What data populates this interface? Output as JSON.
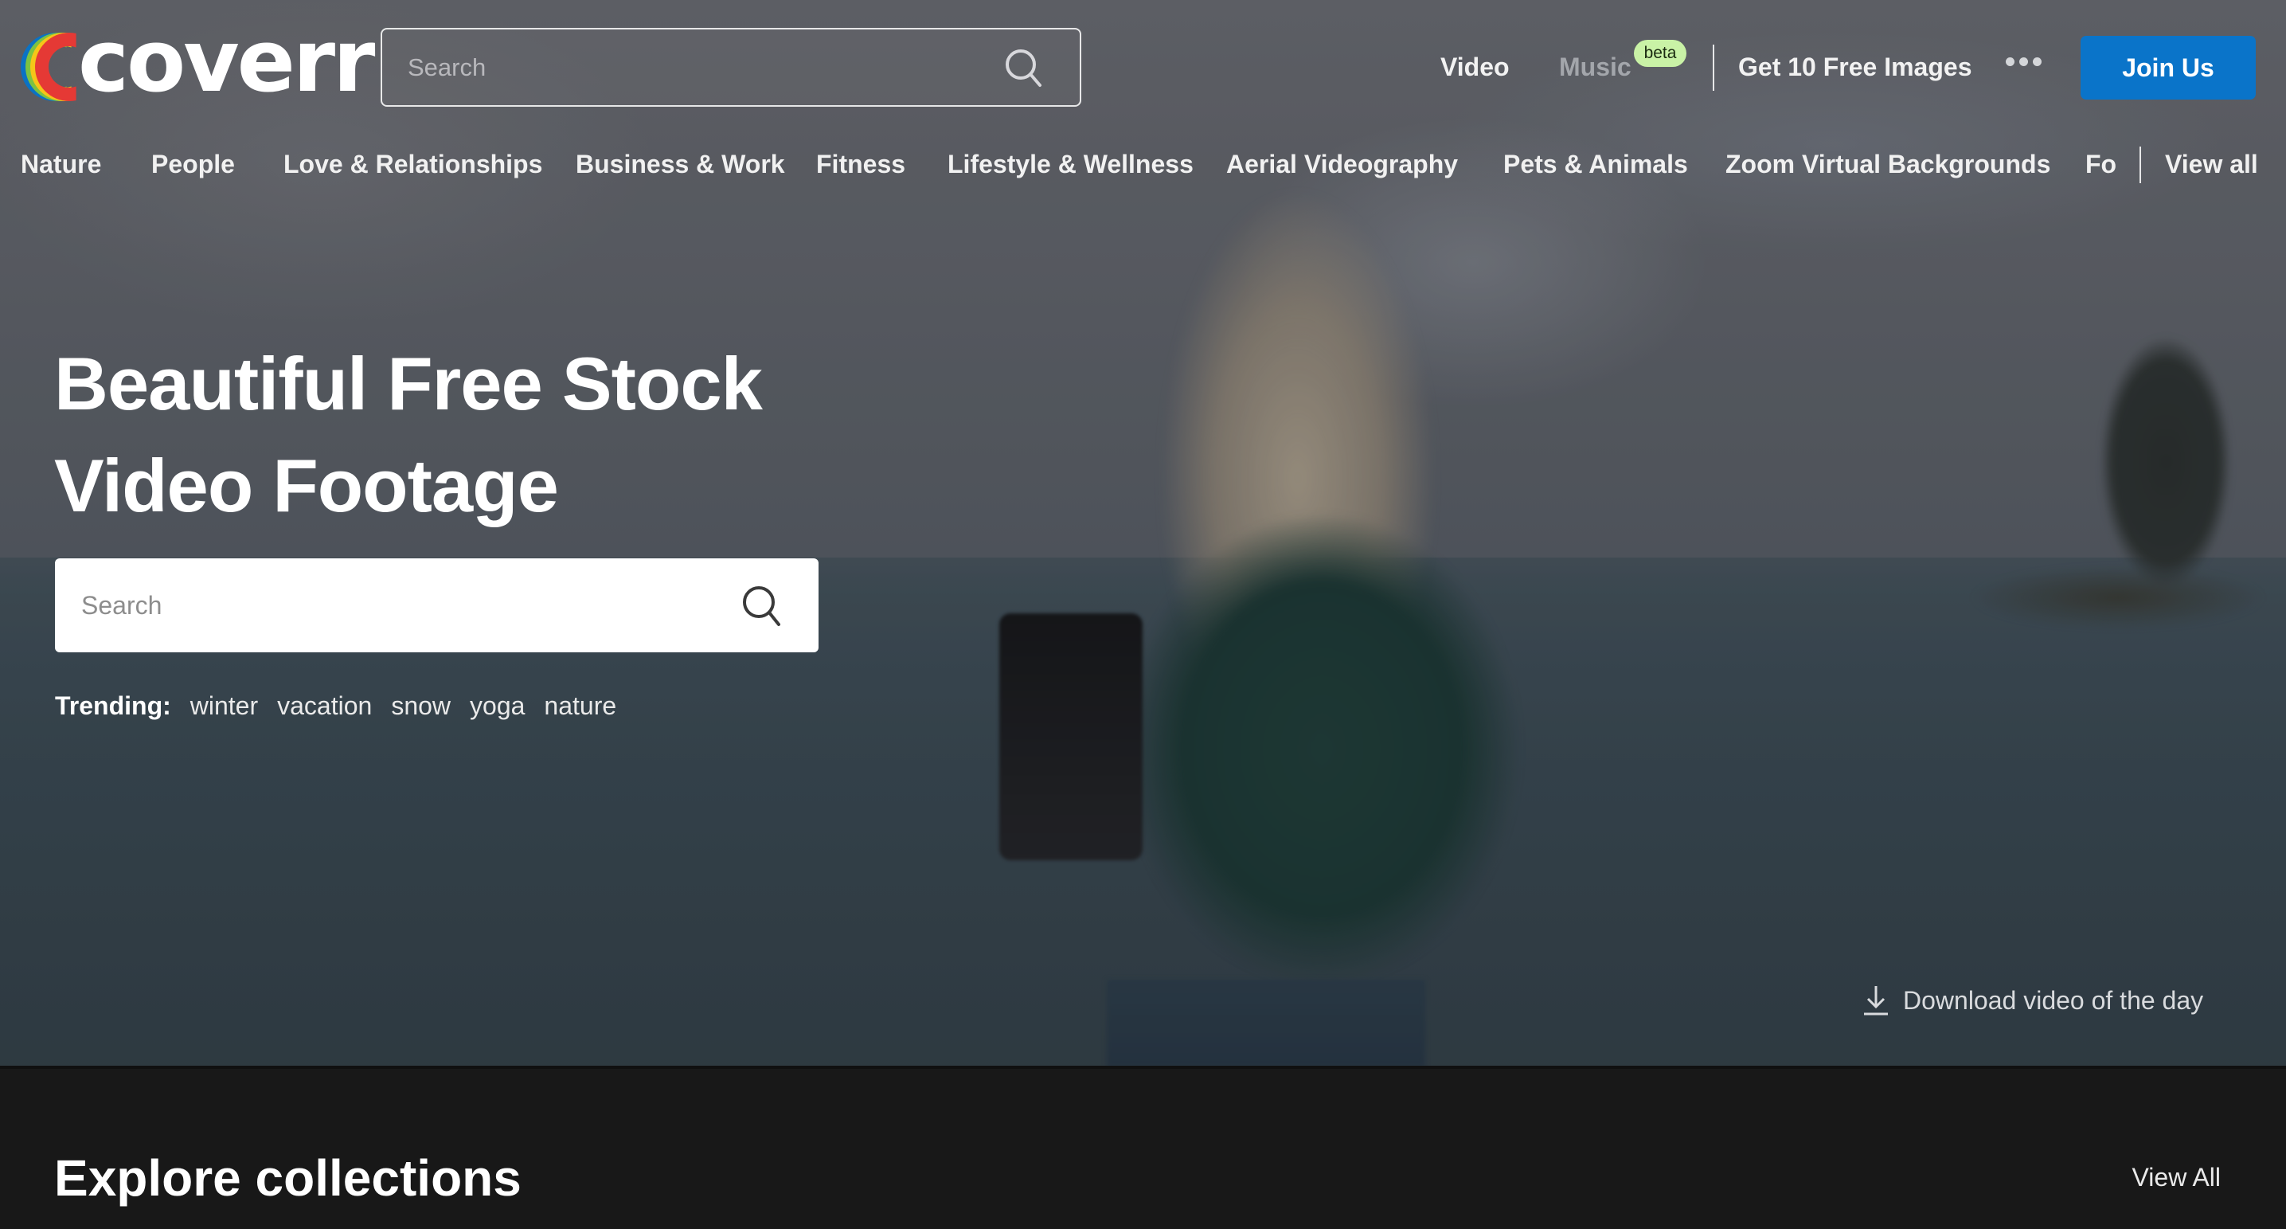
{
  "header": {
    "logo_text": "coverr",
    "logo_colors": [
      "#0a72c4",
      "#7cc242",
      "#f5c518",
      "#e53935"
    ],
    "search_placeholder": "Search",
    "nav": {
      "video": "Video",
      "music": "Music",
      "music_badge": "beta",
      "free_images": "Get 10 Free Images",
      "join": "Join Us"
    },
    "accent_color": "#0a74c9"
  },
  "categories": [
    "Nature",
    "People",
    "Love & Relationships",
    "Business & Work",
    "Fitness",
    "Lifestyle & Wellness",
    "Aerial Videography",
    "Pets & Animals",
    "Zoom Virtual Backgrounds",
    "Fo"
  ],
  "categories_view_all": "View all",
  "hero": {
    "title_line1": "Beautiful Free Stock",
    "title_line2": "Video Footage",
    "search_placeholder": "Search",
    "trending_label": "Trending:",
    "trending": [
      "winter",
      "vacation",
      "snow",
      "yoga",
      "nature"
    ],
    "download_label": "Download video of the day"
  },
  "explore": {
    "title": "Explore collections",
    "view_all": "View All"
  }
}
